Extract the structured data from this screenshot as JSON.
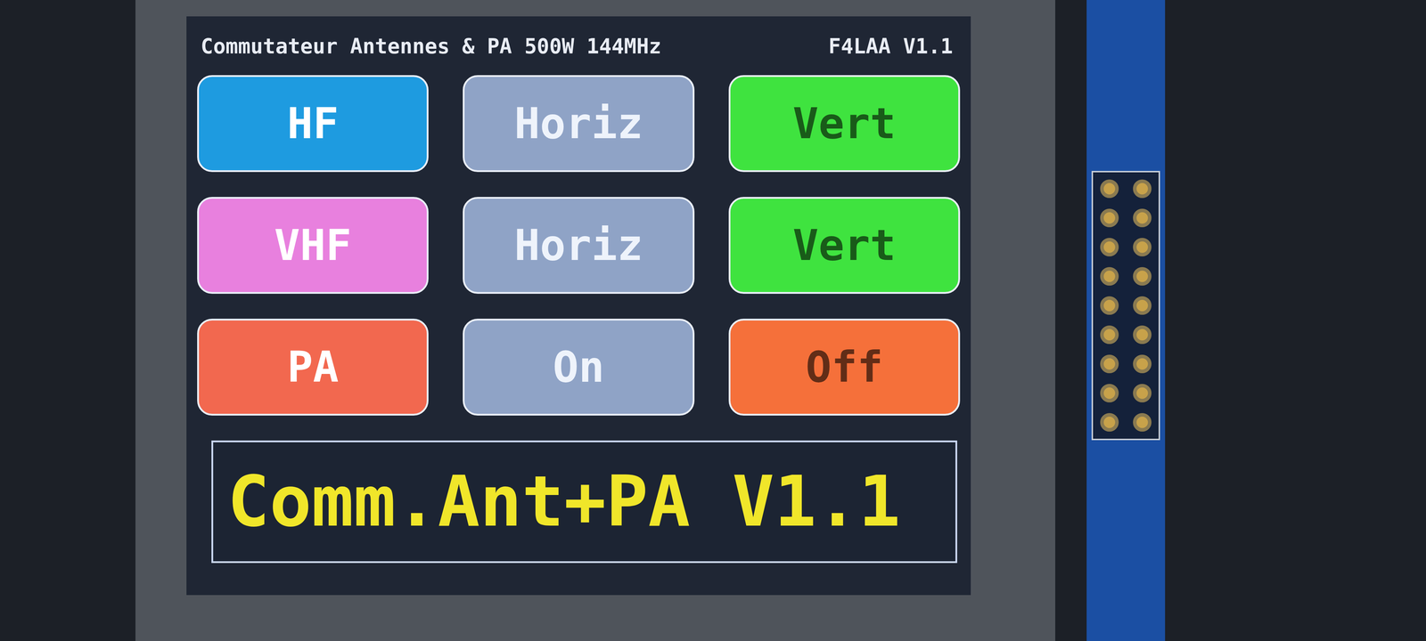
{
  "header": {
    "title": "Commutateur Antennes & PA 500W 144MHz",
    "version": "F4LAA V1.1"
  },
  "rows": [
    {
      "label": "HF",
      "color": "#1e9be0",
      "options": [
        {
          "label": "Horiz",
          "selected": false,
          "color": "#8fa3c6"
        },
        {
          "label": "Vert",
          "selected": true,
          "color": "#3fe33f"
        }
      ]
    },
    {
      "label": "VHF",
      "color": "#e880de",
      "options": [
        {
          "label": "Horiz",
          "selected": false,
          "color": "#8fa3c6"
        },
        {
          "label": "Vert",
          "selected": true,
          "color": "#3fe33f"
        }
      ]
    },
    {
      "label": "PA",
      "color": "#f2684f",
      "options": [
        {
          "label": "On",
          "selected": false,
          "color": "#8fa3c6"
        },
        {
          "label": "Off",
          "selected": true,
          "color": "#f5703a"
        }
      ]
    }
  ],
  "status": "Comm.Ant+PA V1.1"
}
